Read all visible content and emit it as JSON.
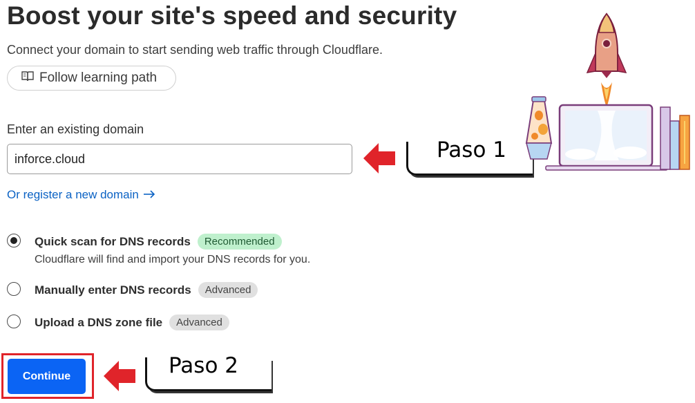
{
  "header": {
    "title": "Boost your site's speed and security",
    "subtitle": "Connect your domain to start sending web traffic through Cloudflare."
  },
  "learning_path": {
    "label": "Follow learning path",
    "icon": "book-open-icon"
  },
  "domain_field": {
    "label": "Enter an existing domain",
    "value": "inforce.cloud",
    "placeholder": ""
  },
  "register_link": {
    "label": "Or register a new domain",
    "icon": "arrow-right-icon"
  },
  "options": [
    {
      "label": "Quick scan for DNS records",
      "badge": "Recommended",
      "description": "Cloudflare will find and import your DNS records for you.",
      "selected": true
    },
    {
      "label": "Manually enter DNS records",
      "badge": "Advanced",
      "selected": false
    },
    {
      "label": "Upload a DNS zone file",
      "badge": "Advanced",
      "selected": false
    }
  ],
  "continue_label": "Continue",
  "annotations": {
    "step1": "Paso 1",
    "step2": "Paso 2",
    "arrow_color": "#e0242a"
  },
  "colors": {
    "primary": "#0b64f4",
    "link": "#0b62c4",
    "badge_recommended": "#bff0cd",
    "badge_advanced": "#e0e0e0"
  }
}
